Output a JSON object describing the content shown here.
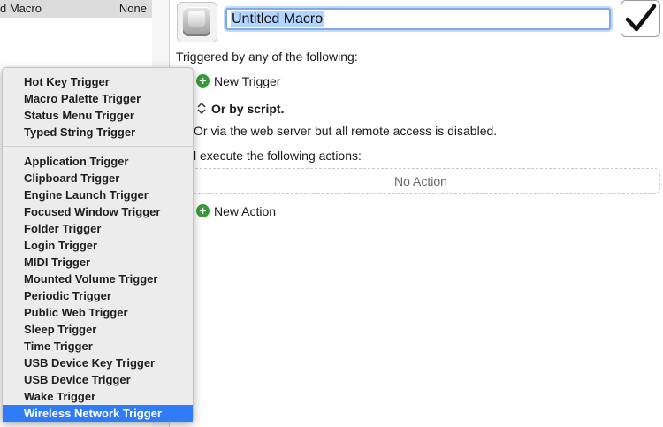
{
  "macro_list": {
    "row": {
      "name": "d Macro",
      "trigger": "None"
    }
  },
  "editor": {
    "macro_name": "Untitled Macro",
    "triggered_label": "Triggered by any of the following:",
    "new_trigger": "New Trigger",
    "or_by_script": "Or by script.",
    "web_server_text": "Or via the web server but all remote access is disabled.",
    "execute_label": "l execute the following actions:",
    "no_action": "No Action",
    "new_action": "New Action",
    "check_icon": "checkmark-icon",
    "accent_color": "#2f7cf6",
    "add_icon_color": "#3a9a3a"
  },
  "trigger_menu": {
    "group1": [
      "Hot Key Trigger",
      "Macro Palette Trigger",
      "Status Menu Trigger",
      "Typed String Trigger"
    ],
    "group2": [
      "Application Trigger",
      "Clipboard Trigger",
      "Engine Launch Trigger",
      "Focused Window Trigger",
      "Folder Trigger",
      "Login Trigger",
      "MIDI Trigger",
      "Mounted Volume Trigger",
      "Periodic Trigger",
      "Public Web Trigger",
      "Sleep Trigger",
      "Time Trigger",
      "USB Device Key Trigger",
      "USB Device Trigger",
      "Wake Trigger",
      "Wireless Network Trigger"
    ],
    "selected": "Wireless Network Trigger"
  }
}
